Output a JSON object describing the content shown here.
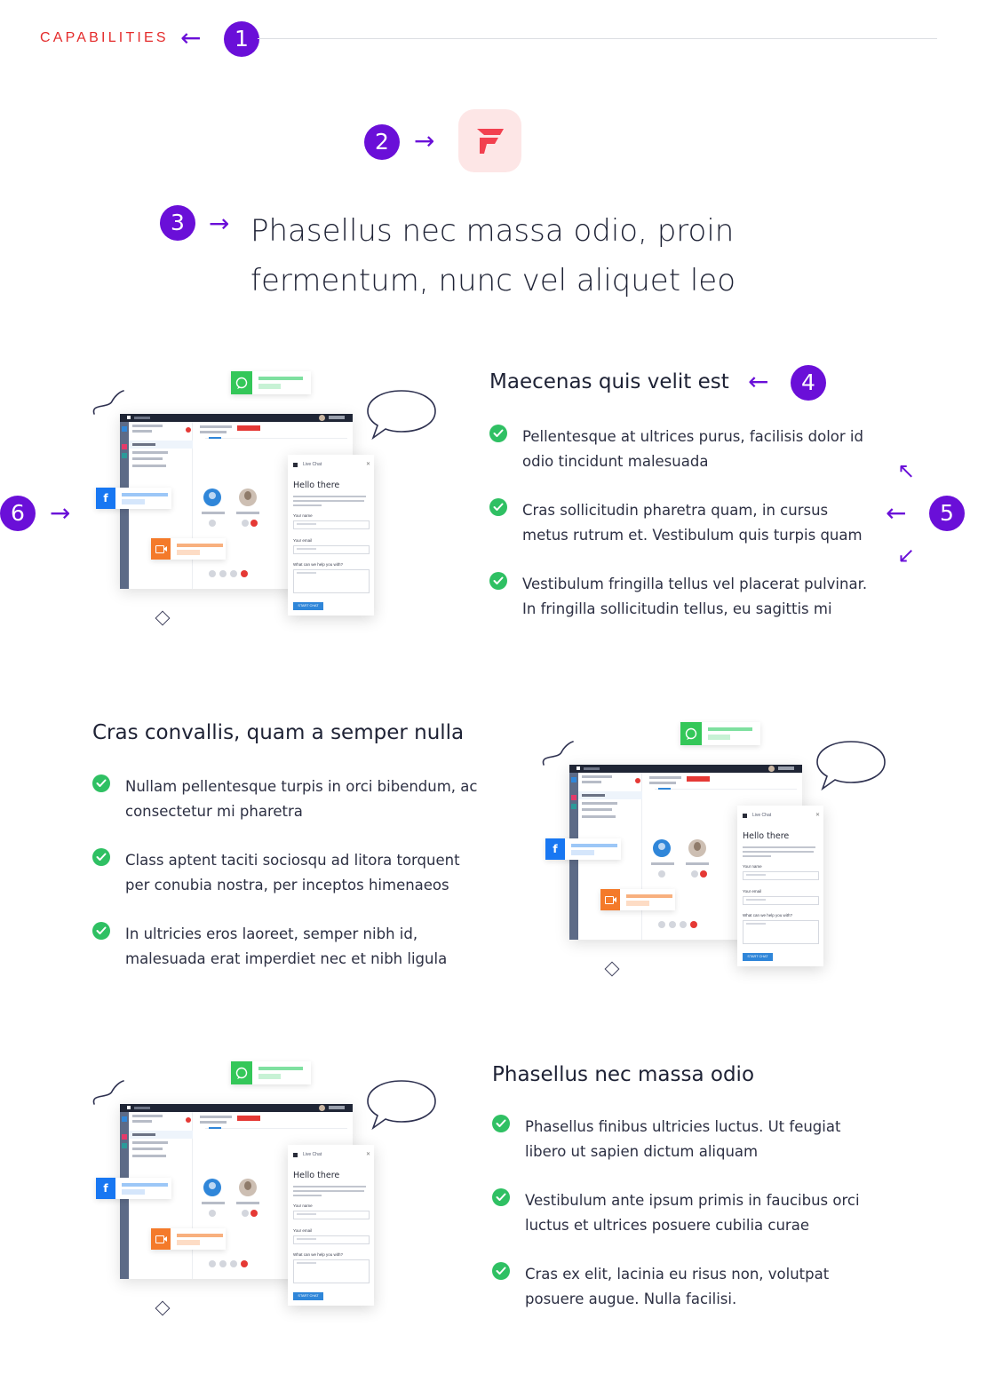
{
  "header": {
    "eyebrow": "CAPABILITIES",
    "headline_line1": "Phasellus nec massa odio, proin",
    "headline_line2": "fermentum, nunc vel aliquet leo"
  },
  "markers": {
    "m1": "1",
    "m2": "2",
    "m3": "3",
    "m4": "4",
    "m5": "5",
    "m6": "6",
    "arrow_left": "←",
    "arrow_right": "→",
    "arrow_up_left": "↖",
    "arrow_down_left": "↙"
  },
  "colors": {
    "accent_purple": "#6a0fd8",
    "eyebrow_red": "#e42b2b",
    "check_green": "#2fc063",
    "logo_tile_bg": "#fde6e6",
    "logo_red": "#f2404f"
  },
  "illustration": {
    "chat_header": "Live Chat",
    "chat_greeting": "Hello there",
    "your_name_label": "Your name",
    "your_email_label": "Your email",
    "help_label": "What can we help you with?",
    "start_button": "START CHAT",
    "facebook_glyph": "f",
    "icons": [
      "whatsapp-icon",
      "facebook-icon",
      "video-icon",
      "speech-bubble-icon",
      "squiggle-decoration",
      "diamond-decoration"
    ]
  },
  "features": [
    {
      "title": "Maecenas quis velit est",
      "items": [
        [
          "Pellentesque at ultrices purus, facilisis dolor id",
          "odio tincidunt malesuada"
        ],
        [
          "Cras sollicitudin pharetra quam, in cursus",
          "metus rutrum et. Vestibulum quis turpis quam"
        ],
        [
          "Vestibulum fringilla tellus vel placerat pulvinar.",
          "In fringilla sollicitudin tellus, eu sagittis mi"
        ]
      ]
    },
    {
      "title": "Cras convallis, quam a semper nulla",
      "items": [
        [
          "Nullam pellentesque turpis in orci bibendum, ac",
          "consectetur mi pharetra"
        ],
        [
          "Class aptent taciti sociosqu ad litora torquent",
          "per conubia nostra, per inceptos himenaeos"
        ],
        [
          "In ultricies eros laoreet, semper nibh id,",
          "malesuada erat imperdiet nec et nibh ligula"
        ]
      ]
    },
    {
      "title": "Phasellus nec massa odio",
      "items": [
        [
          "Phasellus finibus ultricies luctus. Ut feugiat",
          "libero ut sapien dictum aliquam"
        ],
        [
          "Vestibulum ante ipsum primis in faucibus orci",
          "luctus et ultrices posuere cubilia curae"
        ],
        [
          "Cras ex elit, lacinia eu risus non, volutpat",
          "posuere augue. Nulla facilisi."
        ]
      ]
    }
  ]
}
